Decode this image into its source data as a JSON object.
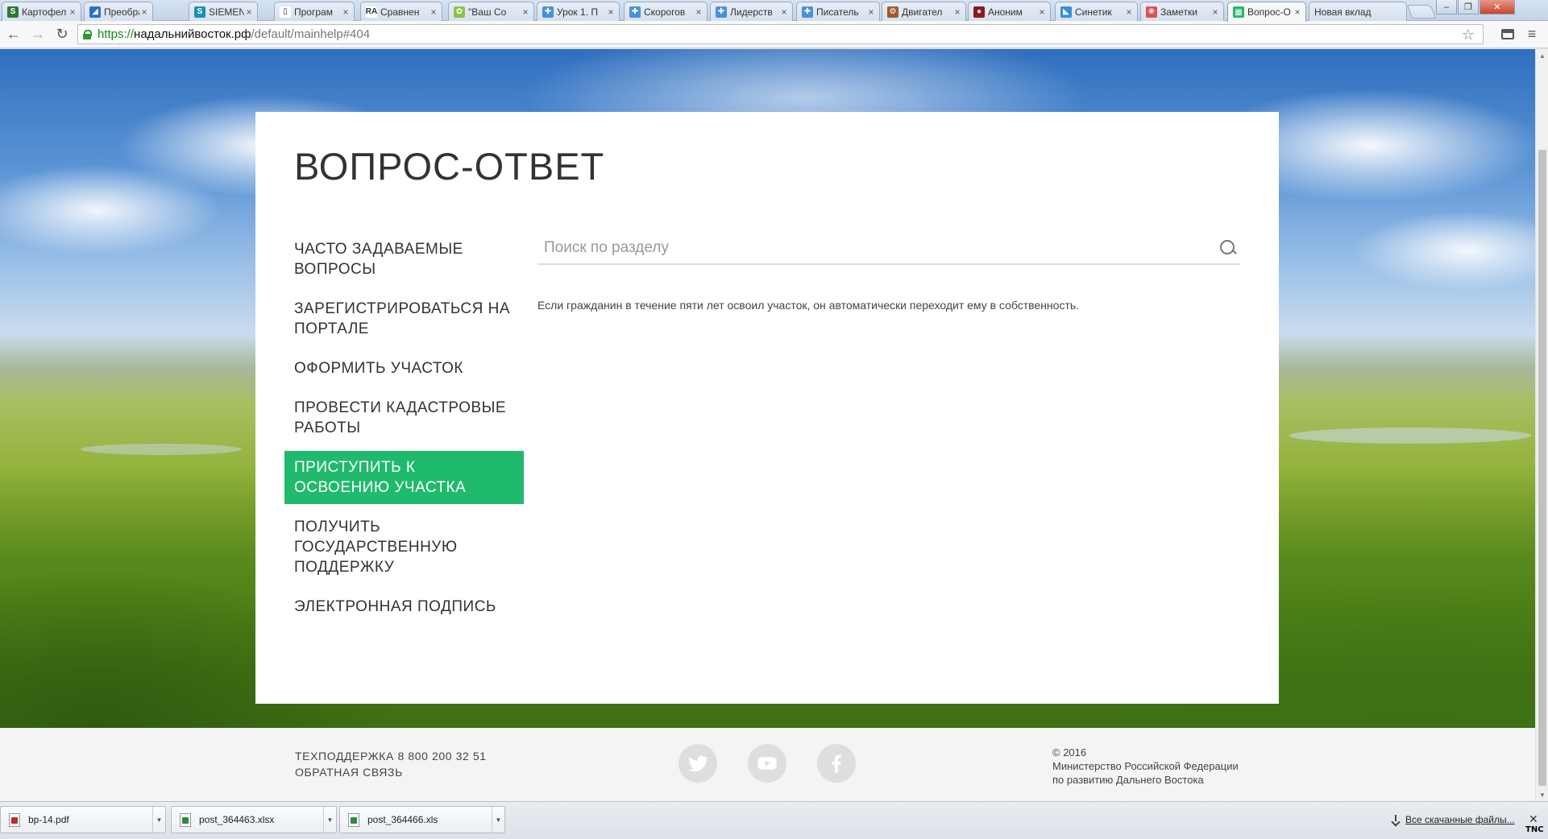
{
  "browser": {
    "tabs": [
      {
        "title": "Картофел",
        "favicon_color": "#2a7a3a",
        "favicon_glyph": "S"
      },
      {
        "title": "Преобра",
        "favicon_color": "#2a6fd0",
        "favicon_glyph": "◢"
      },
      {
        "title": "SIEMENS",
        "favicon_color": "#1a8fb8",
        "favicon_glyph": "S"
      },
      {
        "title": "Програм",
        "favicon_color": "#ffffff",
        "favicon_glyph": "▯"
      },
      {
        "title": "Сравнен",
        "favicon_color": "#ffffff",
        "favicon_glyph": "RA"
      },
      {
        "title": "\"Ваш Со",
        "favicon_color": "#8bc34a",
        "favicon_glyph": "✿"
      },
      {
        "title": "Урок 1. П",
        "favicon_color": "#4a90d9",
        "favicon_glyph": "✚"
      },
      {
        "title": "Скорогов",
        "favicon_color": "#4a90d9",
        "favicon_glyph": "✚"
      },
      {
        "title": "Лидерств",
        "favicon_color": "#4a90d9",
        "favicon_glyph": "✚"
      },
      {
        "title": "Писатель",
        "favicon_color": "#4a90d9",
        "favicon_glyph": "✚"
      },
      {
        "title": "Двигател",
        "favicon_color": "#a05a2c",
        "favicon_glyph": "⚙"
      },
      {
        "title": "Аноним",
        "favicon_color": "#8b1a1a",
        "favicon_glyph": "●"
      },
      {
        "title": "Синетик",
        "favicon_color": "#3a8fd9",
        "favicon_glyph": "◣"
      },
      {
        "title": "Заметки",
        "favicon_color": "#e05050",
        "favicon_glyph": "❀"
      },
      {
        "title": "Вопрос-О",
        "favicon_color": "#1fba6c",
        "favicon_glyph": "▦",
        "active": true
      },
      {
        "title": "Новая вклад",
        "favicon_color": "",
        "favicon_glyph": ""
      }
    ],
    "url": {
      "scheme": "https://",
      "host": "надальнийвосток.рф",
      "path": "/default/mainhelp#404"
    }
  },
  "page": {
    "title": "ВОПРОС-ОТВЕТ",
    "menu": [
      {
        "label": "ЧАСТО ЗАДАВАЕМЫЕ ВОПРОСЫ"
      },
      {
        "label": "ЗАРЕГИСТРИРОВАТЬСЯ НА ПОРТАЛЕ"
      },
      {
        "label": "ОФОРМИТЬ УЧАСТОК"
      },
      {
        "label": "ПРОВЕСТИ КАДАСТРОВЫЕ РАБОТЫ"
      },
      {
        "label": "ПРИСТУПИТЬ К ОСВОЕНИЮ УЧАСТКА",
        "active": true
      },
      {
        "label": "ПОЛУЧИТЬ ГОСУДАРСТВЕННУЮ ПОДДЕРЖКУ"
      },
      {
        "label": "ЭЛЕКТРОННАЯ ПОДПИСЬ"
      }
    ],
    "search": {
      "placeholder": "Поиск по разделу",
      "value": ""
    },
    "answer": "Если гражданин в течение пяти лет освоил участок, он автоматически переходит ему в собственность.",
    "accent_color": "#1fba6c"
  },
  "footer": {
    "support": "ТЕХПОДДЕРЖКА 8 800 200 32 51",
    "feedback": "ОБРАТНАЯ СВЯЗЬ",
    "social": [
      "twitter-icon",
      "youtube-icon",
      "facebook-icon"
    ],
    "copyright_line1": "© 2016",
    "copyright_line2": "Министерство Российской Федерации",
    "copyright_line3": "по развитию Дальнего Востока"
  },
  "downloads": {
    "items": [
      {
        "name": "bp-14.pdf",
        "type": "pdf"
      },
      {
        "name": "post_364463.xlsx",
        "type": "xls"
      },
      {
        "name": "post_364466.xls",
        "type": "xls"
      }
    ],
    "show_all": "Все скачанные файлы..."
  },
  "tray": {
    "badge": "TNC"
  }
}
